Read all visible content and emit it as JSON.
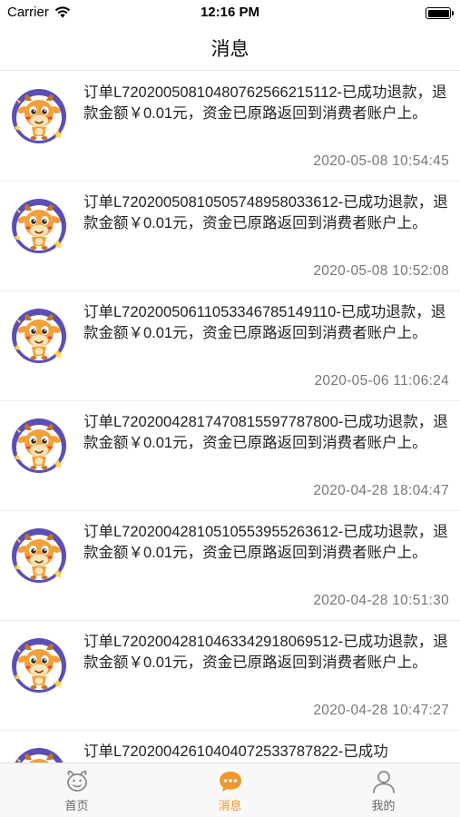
{
  "status_bar": {
    "carrier": "Carrier",
    "time": "12:16 PM"
  },
  "nav": {
    "title": "消息"
  },
  "messages": [
    {
      "text": "订单L72020050810480762566215112-已成功退款，退款金额￥0.01元，资金已原路返回到消费者账户上。",
      "time": "2020-05-08 10:54:45"
    },
    {
      "text": "订单L72020050810505748958033612-已成功退款，退款金额￥0.01元，资金已原路返回到消费者账户上。",
      "time": "2020-05-08 10:52:08"
    },
    {
      "text": "订单L72020050611053346785149110-已成功退款，退款金额￥0.01元，资金已原路返回到消费者账户上。",
      "time": "2020-05-06 11:06:24"
    },
    {
      "text": "订单L72020042817470815597787800-已成功退款，退款金额￥0.01元，资金已原路返回到消费者账户上。",
      "time": "2020-04-28 18:04:47"
    },
    {
      "text": "订单L72020042810510553955263612-已成功退款，退款金额￥0.01元，资金已原路返回到消费者账户上。",
      "time": "2020-04-28 10:51:30"
    },
    {
      "text": "订单L72020042810463342918069512-已成功退款，退款金额￥0.01元，资金已原路返回到消费者账户上。",
      "time": "2020-04-28 10:47:27"
    },
    {
      "text": "订单L72020042610404072533787822-已成功",
      "time": ""
    }
  ],
  "tabs": [
    {
      "label": "首页",
      "icon": "home-icon",
      "active": false
    },
    {
      "label": "消息",
      "icon": "chat-icon",
      "active": true
    },
    {
      "label": "我的",
      "icon": "user-icon",
      "active": false
    }
  ],
  "colors": {
    "accent": "#f0962b",
    "avatar_bg": "#5b4fb6"
  }
}
